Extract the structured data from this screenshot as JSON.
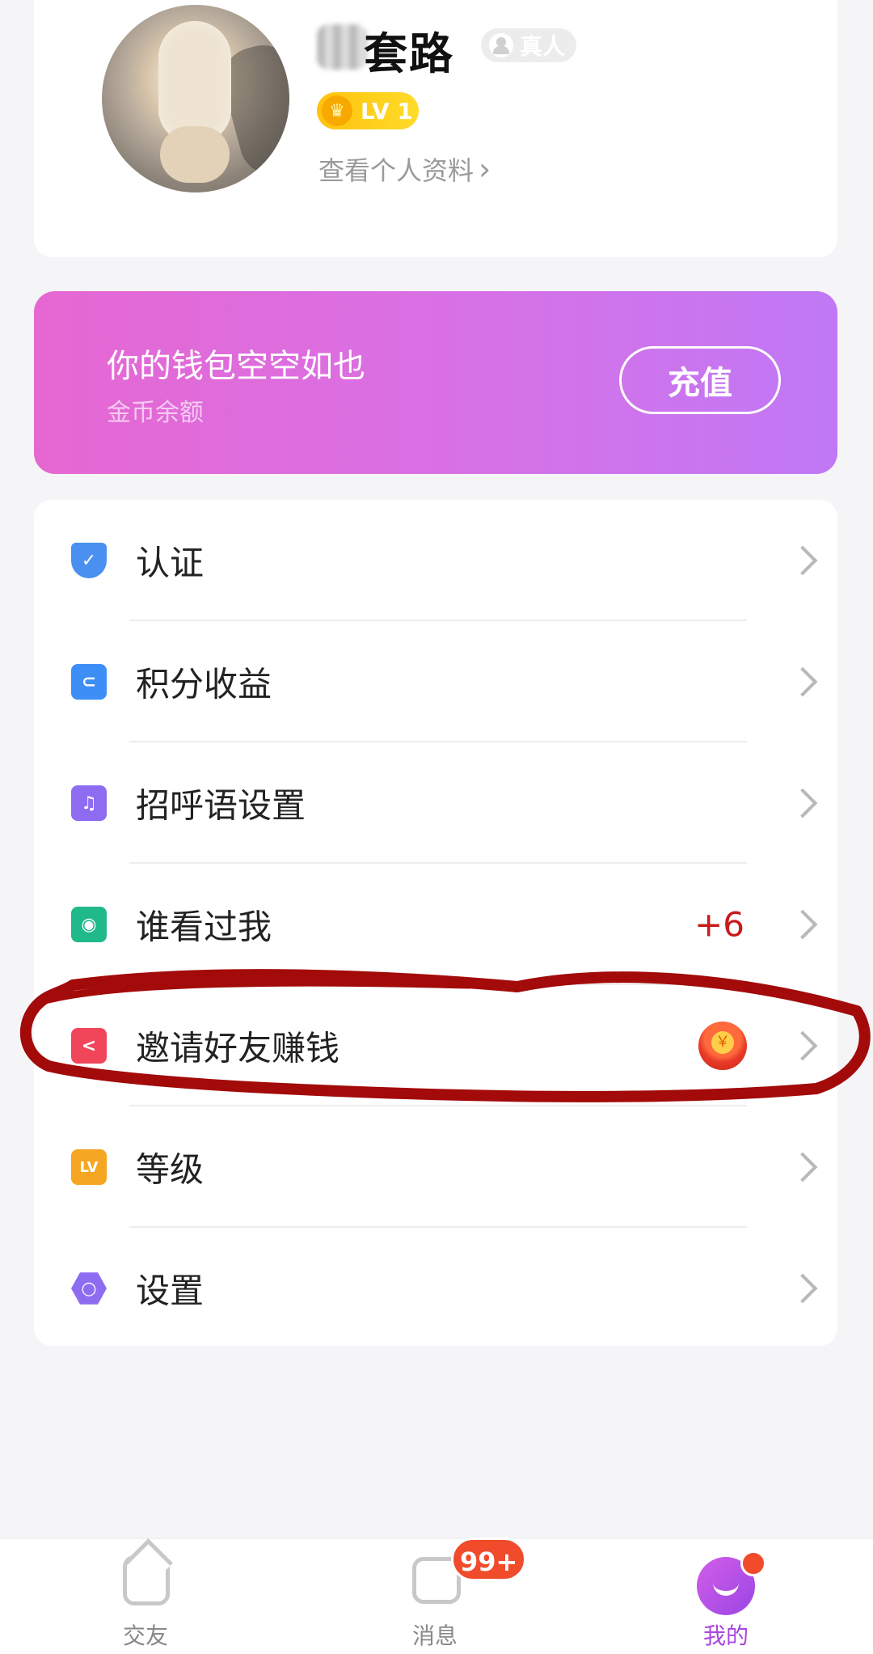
{
  "profile": {
    "username": "套路",
    "verified_label": "真人",
    "level_label": "LV 1",
    "view_profile_label": "查看个人资料",
    "view_profile_chevron": "›"
  },
  "wallet": {
    "title": "你的钱包空空如也",
    "subtitle": "金币余额",
    "recharge_label": "充值"
  },
  "menu": {
    "items": [
      {
        "label": "认证",
        "icon": "shield-check-icon",
        "color": "#4a90f0"
      },
      {
        "label": "积分收益",
        "icon": "wallet-icon",
        "color": "#3e8ef7"
      },
      {
        "label": "招呼语设置",
        "icon": "bell-icon",
        "color": "#8e6cf2"
      },
      {
        "label": "谁看过我",
        "icon": "eye-icon",
        "color": "#20b98a",
        "count": "+6"
      },
      {
        "label": "邀请好友赚钱",
        "icon": "share-icon",
        "color": "#f1455a",
        "extra_icon": "red-envelope-icon"
      },
      {
        "label": "等级",
        "icon": "level-icon",
        "color": "#f5a623",
        "icon_text": "LV"
      },
      {
        "label": "设置",
        "icon": "settings-hexagon-icon",
        "color": "#8e6cf2"
      }
    ]
  },
  "tabbar": {
    "tabs": [
      {
        "label": "交友",
        "icon": "home-icon",
        "color": "#888888"
      },
      {
        "label": "消息",
        "icon": "message-icon",
        "badge": "99+",
        "color": "#888888"
      },
      {
        "label": "我的",
        "icon": "smile-profile-icon",
        "color": "#a847e0"
      }
    ]
  },
  "colors": {
    "wallet_gradient_start": "#e667d2",
    "wallet_gradient_end": "#c078f5",
    "highlight_annotation": "#a30a0a",
    "badge_red": "#f04b2a"
  }
}
